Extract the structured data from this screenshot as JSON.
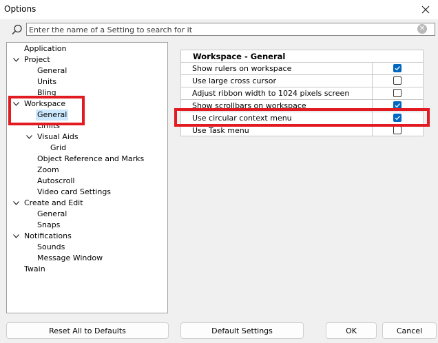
{
  "window": {
    "title": "Options"
  },
  "search": {
    "placeholder": "Enter the name of a Setting to search for it"
  },
  "tree": {
    "application": "Application",
    "project": "Project",
    "project_general": "General",
    "units": "Units",
    "bling": "Bling",
    "workspace": "Workspace",
    "workspace_general": "General",
    "limits": "Limits",
    "visual_aids": "Visual Aids",
    "grid": "Grid",
    "object_reference": "Object Reference and Marks",
    "zoom": "Zoom",
    "autoscroll": "Autoscroll",
    "video_card": "Video card Settings",
    "create_edit": "Create and Edit",
    "create_general": "General",
    "snaps": "Snaps",
    "notifications": "Notifications",
    "sounds": "Sounds",
    "message_window": "Message Window",
    "twain": "Twain"
  },
  "settings": {
    "header": "Workspace - General",
    "rows": [
      {
        "label": "Show rulers on workspace",
        "checked": true
      },
      {
        "label": "Use large cross cursor",
        "checked": false
      },
      {
        "label": "Adjust ribbon width to 1024 pixels screen",
        "checked": false
      },
      {
        "label": "Show scrollbars on workspace",
        "checked": true
      },
      {
        "label": "Use circular context menu",
        "checked": true
      },
      {
        "label": "Use Task menu",
        "checked": false
      }
    ]
  },
  "buttons": {
    "reset": "Reset All to Defaults",
    "defaults": "Default Settings",
    "ok": "OK",
    "cancel": "Cancel"
  },
  "colors": {
    "accent": "#0067c0",
    "highlight": "#e21b22",
    "selection": "#cce8ff"
  }
}
